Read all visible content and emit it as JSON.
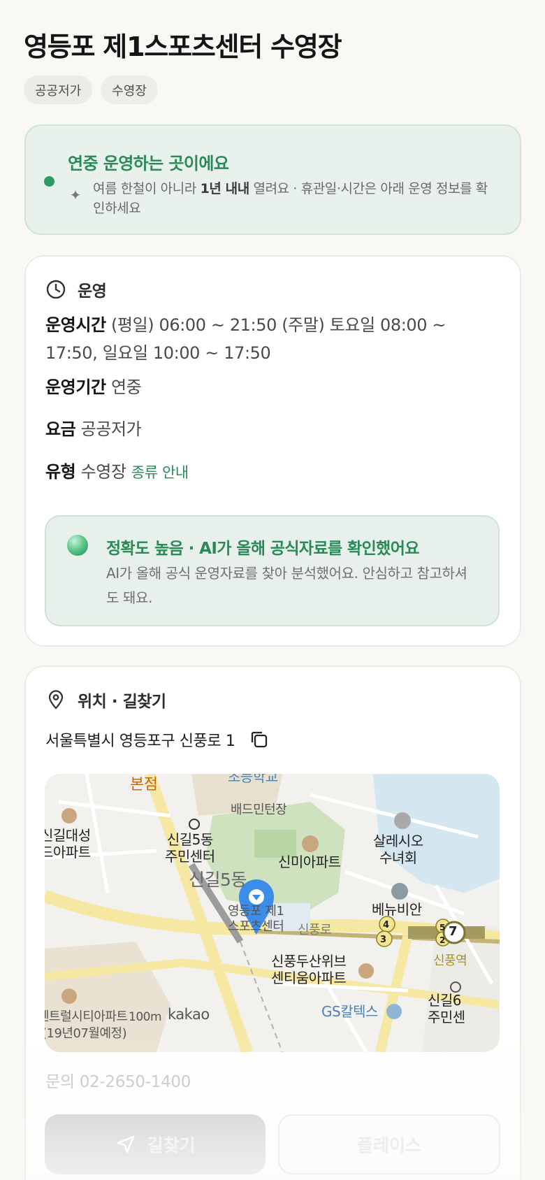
{
  "header": {
    "title": "영등포 제1스포츠센터 수영장",
    "tags": [
      "공공저가",
      "수영장"
    ]
  },
  "notice": {
    "title": "연중 운영하는 곳이에요",
    "body_prefix": "여름 한철이 아니라 ",
    "body_bold": "1년 내내",
    "body_suffix": " 열려요 · 휴관일·시간은 아래 운영 정보를 확인하세요",
    "icon": "sparkle-icon"
  },
  "operation": {
    "section_label": "운영",
    "icon": "clock-icon",
    "hours_key": "운영시간",
    "hours_value": "(평일) 06:00 ~ 21:50 (주말) 토요일 08:00 ~ 17:50, 일요일 10:00 ~ 17:50",
    "period_key": "운영기간",
    "period_value": "연중",
    "fee_key": "요금",
    "fee_value": "공공저가",
    "type_key": "유형",
    "type_value": "수영장",
    "type_link": "종류 안내"
  },
  "ai_badge": {
    "title": "정확도 높음 · AI가 올해 공식자료를 확인했어요",
    "body": "AI가 올해 공식 운영자료를 찾아 분석했어요. 안심하고 참고하셔도 돼요."
  },
  "location": {
    "section_label": "위치 · 길찾기",
    "icon": "location-pin-icon",
    "address": "서울특별시 영등포구 신풍로 1",
    "copy_icon": "copy-icon",
    "map_labels": {
      "top_orange": "본점",
      "top_blue": "초등학교",
      "badminton": "배드민턴장",
      "daesung": "신길대성\n드아파트",
      "community": "신길5동\n주민센터",
      "area": "신길5동",
      "shinmi": "신미아파트",
      "salesio": "살레시오\n수녀회",
      "venue": "영등포 제1\n스포츠센터",
      "road": "신풍로",
      "benyubian": "베뉴비안",
      "doosan": "신풍두산위브\n센티움아파트",
      "station": "신풍역",
      "gs": "GS칼텍스",
      "shingil6": "신길6\n주민센",
      "central": "센트럴시티아파트",
      "central2": "(19년07월예정)",
      "scale": "100m",
      "kakao": "kakao"
    },
    "line_badges": [
      "4",
      "3",
      "5",
      "2",
      "7"
    ],
    "phone": "문의 02-2650-1400"
  },
  "actions": {
    "route_label": "길찾기",
    "route_icon": "navigation-arrow-icon",
    "place_label": "플레이스"
  },
  "colors": {
    "accent_green": "#2a8a57",
    "notice_bg": "#e8f1ec",
    "pin_blue": "#3b8de8"
  }
}
